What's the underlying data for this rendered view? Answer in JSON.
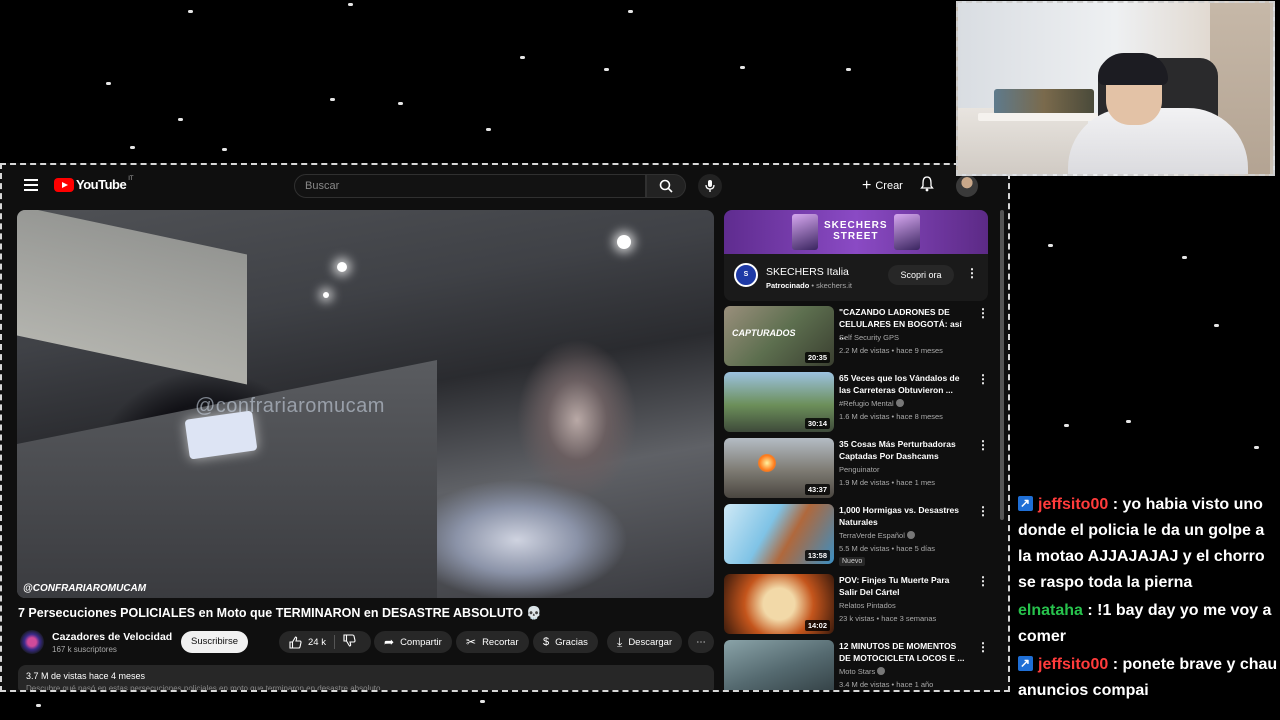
{
  "youtube": {
    "logo_text": "YouTube",
    "logo_region": "IT",
    "search_placeholder": "Buscar",
    "create_label": "Crear"
  },
  "video": {
    "watermark_center": "@confrariaromucam",
    "watermark_corner": "@CONFRARIAROMUCAM",
    "title": "7 Persecuciones POLICIALES en Moto que TERMINARON en DESASTRE ABSOLUTO 💀",
    "channel": "Cazadores de Velocidad",
    "subscribers": "167 k suscriptores",
    "subscribe_label": "Suscribirse",
    "likes": "24 k",
    "actions": [
      "Compartir",
      "Recortar",
      "Gracias",
      "Descargar"
    ],
    "views_date": "3.7 M de vistas  hace 4 meses",
    "description_line": "Descubre qué pasó en estas persecuciones policiales en moto que terminaron en desastre absoluto"
  },
  "ad": {
    "banner_line1": "SKECHERS",
    "banner_line2": "STREET",
    "name": "SKECHERS Italia",
    "sponsored": "Patrocinado",
    "domain": "skechers.it",
    "cta": "Scopri ora"
  },
  "recommendations": [
    {
      "title": "\"CAZANDO LADRONES DE CELULARES EN BOGOTÁ: así ...",
      "channel": "Self Security GPS",
      "meta": "2.2 M de vistas • hace 9 meses",
      "duration": "20:35",
      "thumb_text": "CAPTURADOS"
    },
    {
      "title": "65 Veces que los Vándalos de las Carreteras Obtuvieron ...",
      "channel": "#Refugio Mental",
      "meta": "1.6 M de vistas • hace 8 meses",
      "duration": "30:14"
    },
    {
      "title": "35 Cosas Más Perturbadoras Captadas Por Dashcams",
      "channel": "Penguinator",
      "meta": "1.9 M de vistas • hace 1 mes",
      "duration": "43:37"
    },
    {
      "title": "1,000 Hormigas vs. Desastres Naturales",
      "channel": "TerraVerde Español",
      "meta": "5.5 M de vistas • hace 5 días",
      "duration": "13:58",
      "badge": "Nuevo"
    },
    {
      "title": "POV: Finjes Tu Muerte Para Salir Del Cártel",
      "channel": "Relatos Pintados",
      "meta": "23 k vistas • hace 3 semanas",
      "duration": "14:02"
    },
    {
      "title": "12 MINUTOS DE MOMENTOS DE MOTOCICLETA LOCOS E ...",
      "channel": "Moto Stars",
      "meta": "3.4 M de vistas • hace 1 año",
      "duration": ""
    }
  ],
  "chat": [
    {
      "user": "jeffsito00",
      "text": ": yo habia visto uno donde el policia le da un golpe a la motao AJJAJAJAJ y el chorro se raspo toda la pierna",
      "badge": true,
      "color": "#ff3b3b"
    },
    {
      "user": "elnataha",
      "text": ": !1 bay day yo me voy a comer",
      "badge": false,
      "color": "#27c24c"
    },
    {
      "user": "jeffsito00",
      "text": ": ponete brave y chau anuncios compai",
      "badge": true,
      "color": "#ff3b3b"
    }
  ]
}
